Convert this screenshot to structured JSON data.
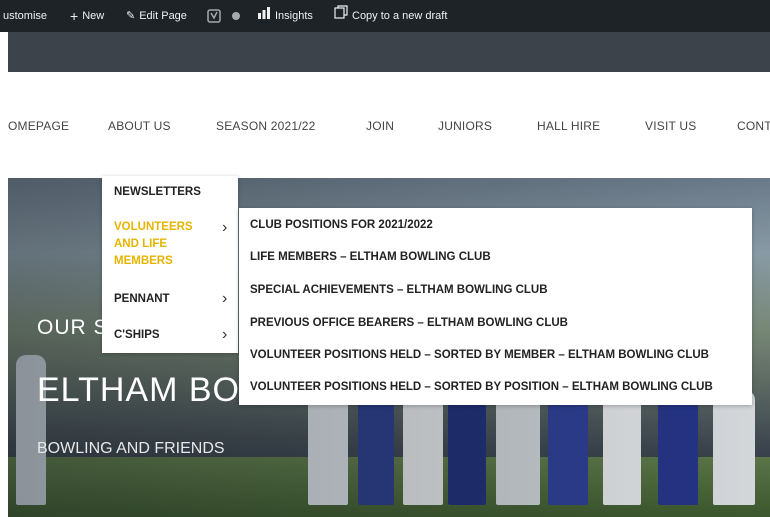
{
  "admin_bar": {
    "customise": "ustomise",
    "new": "New",
    "edit_page": "Edit Page",
    "insights": "Insights",
    "copy_draft": "Copy to a new draft"
  },
  "nav": {
    "items": [
      "OMEPAGE",
      "ABOUT US",
      "SEASON 2021/22",
      "JOIN",
      "JUNIORS",
      "HALL HIRE",
      "VISIT US",
      "CONT"
    ]
  },
  "hero": {
    "line1": "OUR S",
    "line2": "ELTHAM BOV",
    "line3": "BOWLING AND FRIENDS"
  },
  "submenu1": {
    "items": [
      "NEWSLETTERS",
      "VOLUNTEERS AND LIFE MEMBERS",
      "PENNANT",
      "C'SHIPS"
    ],
    "active_color": "#e6b400"
  },
  "submenu2": {
    "items": [
      "CLUB POSITIONS FOR 2021/2022",
      "LIFE MEMBERS – ELTHAM BOWLING CLUB",
      "SPECIAL ACHIEVEMENTS – ELTHAM BOWLING CLUB",
      "PREVIOUS OFFICE BEARERS – ELTHAM BOWLING CLUB",
      "VOLUNTEER POSITIONS HELD – SORTED BY MEMBER – ELTHAM BOWLING CLUB",
      "VOLUNTEER POSITIONS HELD – SORTED BY POSITION – ELTHAM BOWLING CLUB"
    ]
  },
  "colors": {
    "admin_bar": "#1d2327",
    "accent": "#e6b400"
  }
}
